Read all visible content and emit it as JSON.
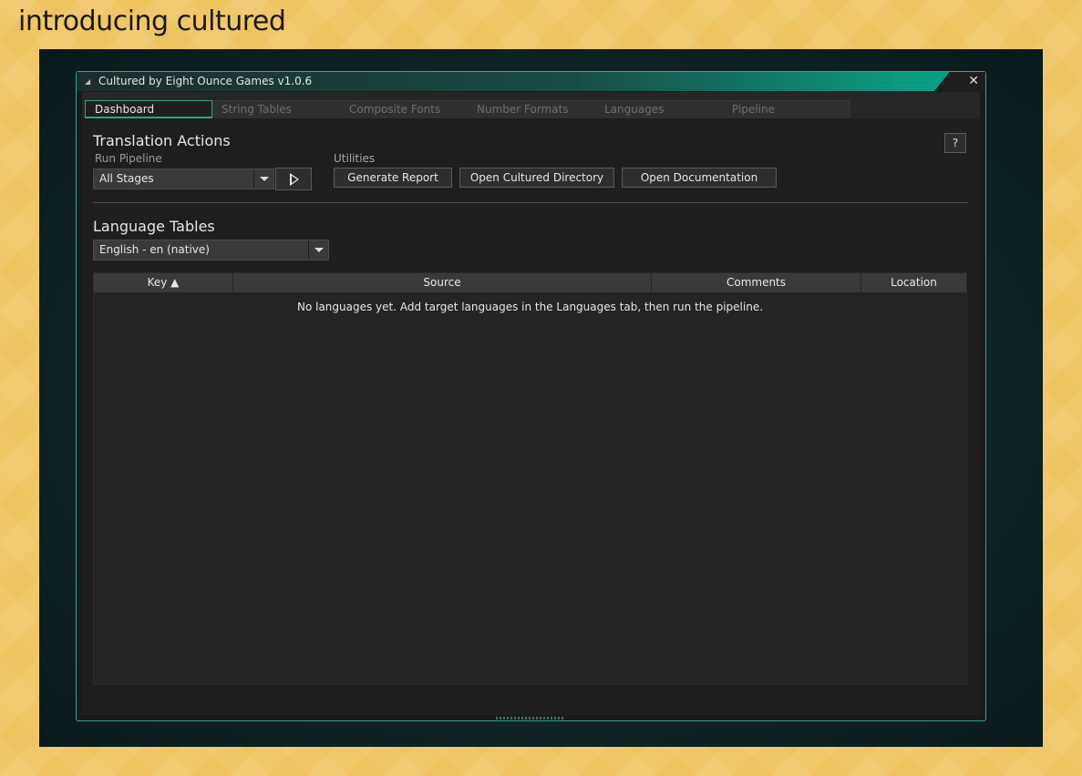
{
  "headline": "introducing cultured",
  "window": {
    "title": "Cultured by Eight Ounce Games  v1.0.6",
    "close_glyph": "✕"
  },
  "tabs": [
    {
      "label": "Dashboard",
      "active": true
    },
    {
      "label": "String Tables",
      "active": false
    },
    {
      "label": "Composite Fonts",
      "active": false
    },
    {
      "label": "Number Formats",
      "active": false
    },
    {
      "label": "Languages",
      "active": false
    },
    {
      "label": "Pipeline",
      "active": false
    }
  ],
  "translation_actions": {
    "title": "Translation Actions",
    "run_pipeline_label": "Run Pipeline",
    "stage_select_value": "All Stages",
    "utilities_label": "Utilities",
    "generate_report": "Generate Report",
    "open_directory": "Open Cultured Directory",
    "open_documentation": "Open Documentation",
    "help_label": "?"
  },
  "language_tables": {
    "title": "Language Tables",
    "language_select_value": "English - en (native)",
    "columns": [
      "Key ▲",
      "Source",
      "Comments",
      "Location"
    ],
    "empty_message": "No languages yet. Add target languages in the Languages tab, then run the pipeline."
  },
  "icons": {
    "collapse": "triangle-down-icon",
    "close": "close-icon",
    "play": "play-icon",
    "dropdown": "chevron-down-icon"
  },
  "colors": {
    "accent": "#2fa58a",
    "background": "#efc35f",
    "panel": "#1e1e1e"
  }
}
